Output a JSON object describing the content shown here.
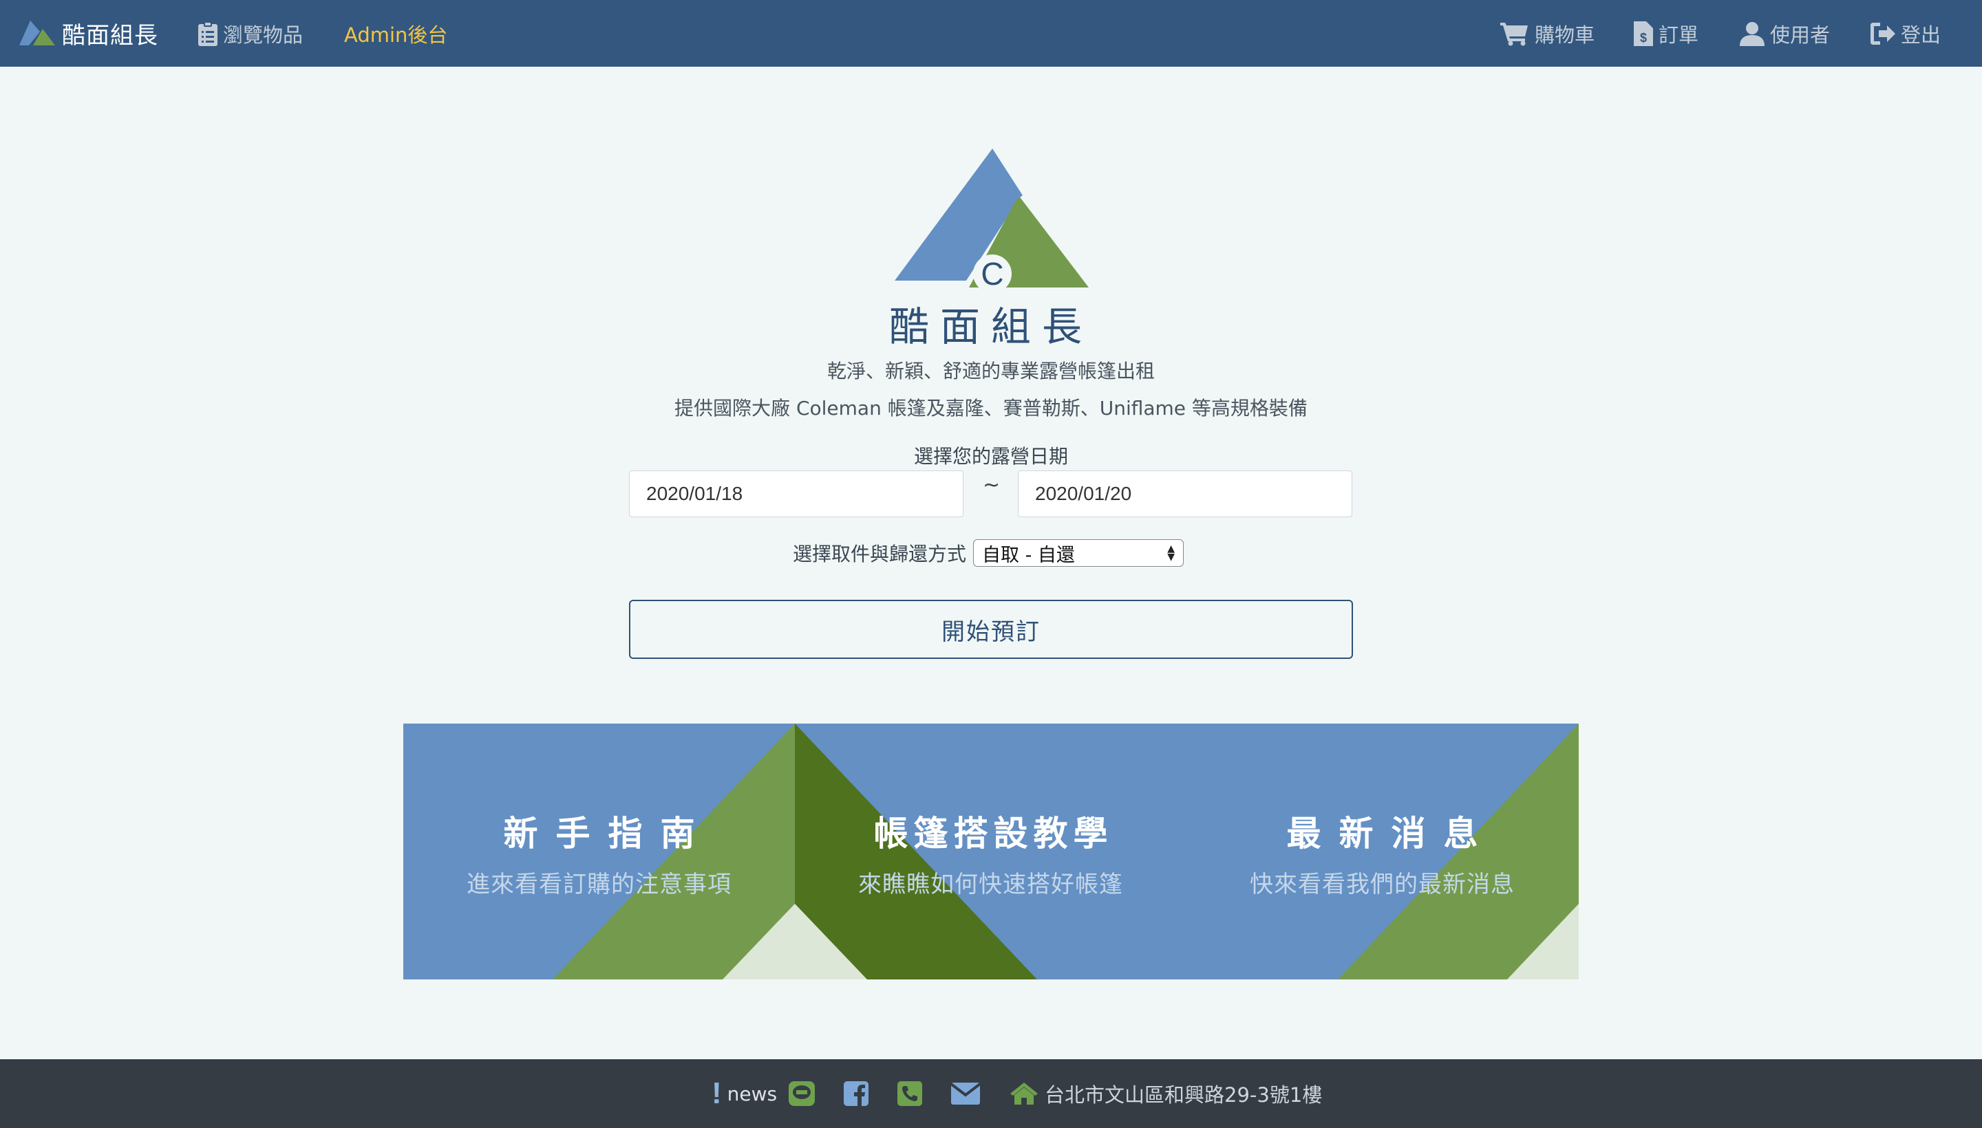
{
  "navbar": {
    "brand": "酷面組長",
    "browse": "瀏覽物品",
    "admin": "Admin後台",
    "cart": "購物車",
    "orders": "訂單",
    "user": "使用者",
    "logout": "登出"
  },
  "hero": {
    "logo_letter": "C",
    "title": "酷面組長",
    "subtitle1": "乾淨、新穎、舒適的專業露營帳篷出租",
    "subtitle2": "提供國際大廠 Coleman 帳篷及嘉隆、賽普勒斯、Uniflame 等高規格裝備"
  },
  "booking": {
    "date_label": "選擇您的露營日期",
    "start_date": "2020/01/18",
    "end_date": "2020/01/20",
    "separator": "~",
    "method_label": "選擇取件與歸還方式",
    "method_value": "自取 - 自還",
    "submit": "開始預訂"
  },
  "banner": {
    "cards": [
      {
        "title": "新手指南",
        "subtitle": "進來看看訂購的注意事項"
      },
      {
        "title": "帳篷搭設教學",
        "subtitle": "來瞧瞧如何快速搭好帳篷"
      },
      {
        "title": "最新消息",
        "subtitle": "快來看看我們的最新消息"
      }
    ]
  },
  "footer": {
    "news_mark": "!",
    "news": "news",
    "address": "台北市文山區和興路29-3號1樓"
  },
  "colors": {
    "navbar": "#33577f",
    "brand_blue": "#6490c4",
    "brand_green": "#749b4d",
    "dark_green": "#4e721e",
    "admin_yellow": "#f5c542",
    "footer": "#363c44",
    "footer_icon_green": "#6fa24c",
    "footer_icon_blue": "#7ea8d8"
  },
  "icons": [
    "logo-icon",
    "clipboard-icon",
    "cart-icon",
    "invoice-icon",
    "user-icon",
    "logout-icon",
    "line-icon",
    "facebook-icon",
    "phone-icon",
    "mail-icon",
    "home-icon"
  ]
}
